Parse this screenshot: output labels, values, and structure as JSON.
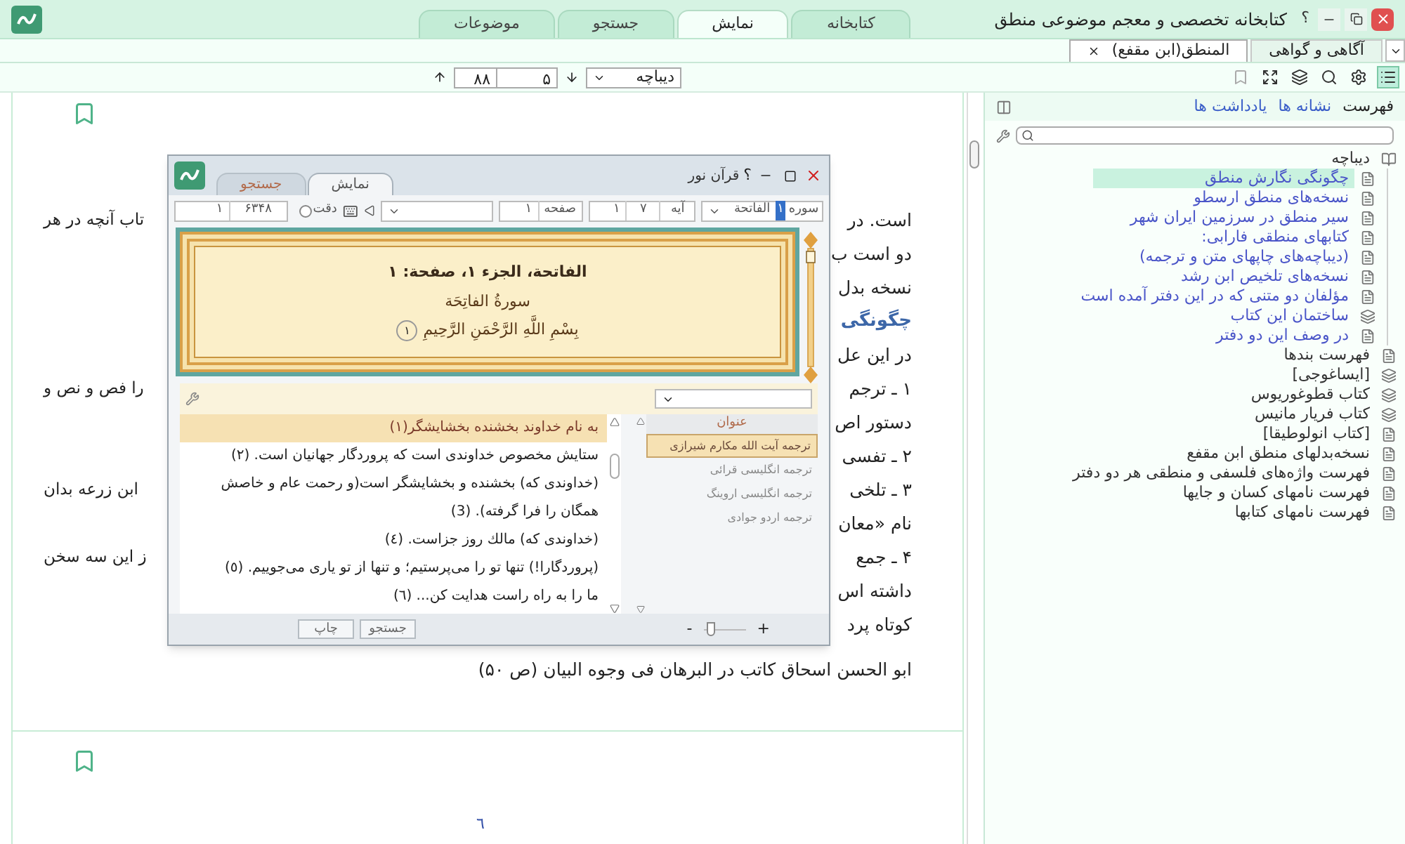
{
  "window": {
    "title": "کتابخانه تخصصی و معجم موضوعی منطق",
    "help": "؟"
  },
  "main_tabs": [
    {
      "label": "کتابخانه",
      "selected": false
    },
    {
      "label": "نمایش",
      "selected": true
    },
    {
      "label": "جستجو",
      "selected": false
    },
    {
      "label": "موضوعات",
      "selected": false
    }
  ],
  "doc_tabs": [
    {
      "label": "آگاهی و گواهی",
      "selected": false,
      "closable": false
    },
    {
      "label": "المنطق(ابن مقفع)",
      "selected": true,
      "closable": true
    }
  ],
  "tools": [
    {
      "kind": "list",
      "selected": true
    },
    {
      "kind": "settings",
      "selected": false
    },
    {
      "kind": "search",
      "selected": false
    },
    {
      "kind": "layers",
      "selected": false
    },
    {
      "kind": "expand",
      "selected": false
    },
    {
      "kind": "bookmark",
      "selected": false
    }
  ],
  "navigator": {
    "section": "دیباچه",
    "page": "۵",
    "total": "۸۸"
  },
  "document": {
    "lines": [
      {
        "kind": "text",
        "right": "است. در",
        "left": "تاب آنچه در هر"
      },
      {
        "kind": "text",
        "right": "دو است ب"
      },
      {
        "kind": "text",
        "right": "نسخه بدل"
      },
      {
        "kind": "heading",
        "right": "چگونگی"
      },
      {
        "kind": "text",
        "right": "در این عل"
      },
      {
        "kind": "text",
        "right": "۱ ـ ترجم",
        "left": "را فص و نص و"
      },
      {
        "kind": "text",
        "right": "دستور اص"
      },
      {
        "kind": "text",
        "right": "۲ ـ تفسی"
      },
      {
        "kind": "text",
        "right": "۳ ـ تلخی",
        "left": "ابن زرعه بدان"
      },
      {
        "kind": "text",
        "right": "نام «معان"
      },
      {
        "kind": "text",
        "right": "۴ ـ جمع",
        "left": "ز این سه سخن"
      },
      {
        "kind": "text",
        "right": "داشته اس"
      },
      {
        "kind": "text",
        "right": "کوتاه پرد"
      },
      {
        "kind": "text",
        "right": "ابو الحسن اسحاق کاتب در البرهان فی وجوه البیان (ص ۵۰)"
      }
    ],
    "page_number": "٦"
  },
  "sidebar": {
    "tabs": [
      {
        "label": "فهرست",
        "selected": true
      },
      {
        "label": "نشانه ها",
        "selected": false
      },
      {
        "label": "یادداشت ها",
        "selected": false
      }
    ],
    "toc": [
      {
        "label": "دیباچه",
        "kind": "book",
        "selected": false,
        "children": [
          {
            "label": "چگونگی نگارش منطق",
            "kind": "page",
            "selected": true
          },
          {
            "label": "نسخه‌های منطق ارسطو",
            "kind": "page",
            "selected": false
          },
          {
            "label": "سیر منطق در سرزمین ایران شهر",
            "kind": "page",
            "selected": false
          },
          {
            "label": "کتابهای منطقی فارابی:",
            "kind": "page",
            "selected": false
          },
          {
            "label": "(دیباچه‌های چاپهای متن و ترجمه)",
            "kind": "page",
            "selected": false
          },
          {
            "label": "نسخه‌های تلخیص ابن رشد",
            "kind": "page",
            "selected": false
          },
          {
            "label": "مؤلفان دو متنی که در این دفتر آمده است",
            "kind": "page",
            "selected": false
          },
          {
            "label": "ساختمان این کتاب",
            "kind": "section",
            "selected": false
          },
          {
            "label": "در وصف این دو دفتر",
            "kind": "page",
            "selected": false
          }
        ]
      },
      {
        "label": "فهرست بندها",
        "kind": "page",
        "selected": false
      },
      {
        "label": "[ایساغوجی]",
        "kind": "section",
        "selected": false
      },
      {
        "label": "کتاب قطوغوریوس",
        "kind": "section",
        "selected": false
      },
      {
        "label": "کتاب فریار مانیس",
        "kind": "section",
        "selected": false
      },
      {
        "label": "[کتاب انولوطیقا]",
        "kind": "page",
        "selected": false
      },
      {
        "label": "نسخه‌بدلهای منطق ابن مقفع",
        "kind": "page",
        "selected": false
      },
      {
        "label": "فهرست واژه‌های فلسفی و منطقی هر دو دفتر",
        "kind": "page",
        "selected": false
      },
      {
        "label": "فهرست نامهای کسان و جایها",
        "kind": "page",
        "selected": false
      },
      {
        "label": "فهرست نامهای کتابها",
        "kind": "page",
        "selected": false
      }
    ]
  },
  "quran_window": {
    "title": "قرآن نور",
    "help": "؟",
    "tabs": [
      {
        "label": "نمایش",
        "selected": true
      },
      {
        "label": "جستجو",
        "selected": false
      }
    ],
    "surah_label": "سوره",
    "surah_number": "۱",
    "surah_name": "الفاتحة",
    "ayah_label": "آیه",
    "ayah_total": "۷",
    "ayah": "۱",
    "page_label": "صفحه",
    "page": "۱",
    "exact_label": "دقت",
    "exact_checked": false,
    "count_total": "۶۳۴۸",
    "count": "۱",
    "header": {
      "location": "الفاتحة، الجزء ۱، صفحة: ۱",
      "surah_title": "سورةُ الفاتِحَة",
      "basmala": "بِسْمِ اللَّهِ الرَّحْمَنِ الرَّحِيمِ",
      "verse_marker": "۱"
    },
    "verses": [
      {
        "text": "به نام خداوند بخشنده بخشایشگر(۱)",
        "selected": true
      },
      {
        "text": "ستایش مخصوص خداوندی است که پروردگار جهانیان است. (۲)",
        "selected": false
      },
      {
        "text": "(خداوندی که) بخشنده و بخشایشگر است(و رحمت عام و خاصش همگان را فرا گرفته). (3)",
        "selected": false
      },
      {
        "text": "(خداوندی که) مالك روز جزاست. (٤)",
        "selected": false
      },
      {
        "text": "(پروردگارا!) تنها تو را می‌پرستیم؛ و تنها از تو یاری می‌جوییم. (٥)",
        "selected": false
      },
      {
        "text": "ما را به راه راست هدایت کن... (٦)",
        "selected": false
      }
    ],
    "translations_header": "عنوان",
    "translations": [
      {
        "label": "ترجمه آیت الله مکارم شیرازی",
        "selected": true
      },
      {
        "label": "ترجمه انگلیسی قرائی",
        "selected": false
      },
      {
        "label": "ترجمه انگلیسی اروینگ",
        "selected": false
      },
      {
        "label": "ترجمه اردو جوادی",
        "selected": false
      }
    ],
    "buttons": [
      "جستجو",
      "چاپ"
    ],
    "zoom": {
      "minus": "-",
      "plus": "+",
      "level": 0.1
    }
  }
}
